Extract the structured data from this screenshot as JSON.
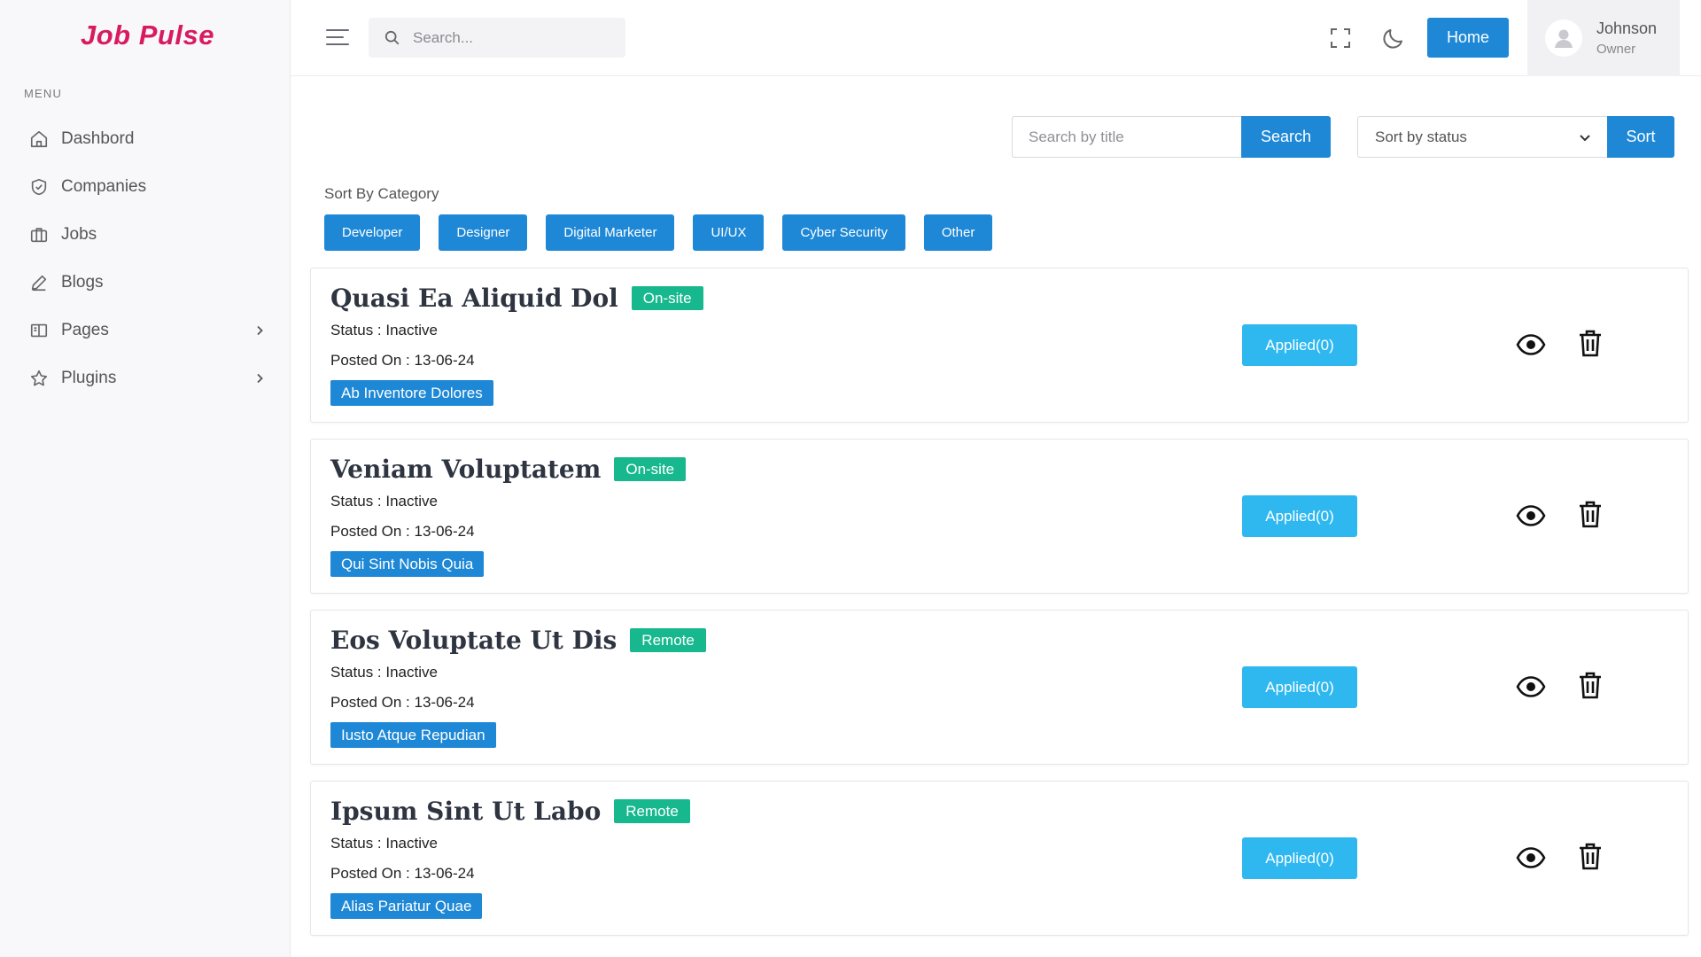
{
  "brand": "Job Pulse",
  "sidebar": {
    "menu_label": "MENU",
    "items": [
      {
        "label": "Dashbord",
        "icon": "home-icon"
      },
      {
        "label": "Companies",
        "icon": "shield-icon"
      },
      {
        "label": "Jobs",
        "icon": "briefcase-icon"
      },
      {
        "label": "Blogs",
        "icon": "pen-icon"
      },
      {
        "label": "Pages",
        "icon": "book-icon",
        "has_submenu": true
      },
      {
        "label": "Plugins",
        "icon": "star-icon",
        "has_submenu": true
      }
    ]
  },
  "header": {
    "search_placeholder": "Search...",
    "home_label": "Home",
    "user": {
      "name": "Johnson",
      "role": "Owner"
    }
  },
  "toolbar": {
    "title_search_placeholder": "Search by title",
    "search_label": "Search",
    "sort_select_value": "Sort by status",
    "sort_label": "Sort"
  },
  "categories": {
    "label": "Sort By Category",
    "items": [
      "Developer",
      "Designer",
      "Digital Marketer",
      "UI/UX",
      "Cyber Security",
      "Other"
    ]
  },
  "jobs": [
    {
      "title": "Quasi Ea Aliquid Dol",
      "type": "On-site",
      "status": "Status : Inactive",
      "posted": "Posted On : 13-06-24",
      "company": "Ab Inventore Dolores",
      "applied": "Applied(0)"
    },
    {
      "title": "Veniam Voluptatem",
      "type": "On-site",
      "status": "Status : Inactive",
      "posted": "Posted On : 13-06-24",
      "company": "Qui Sint Nobis Quia",
      "applied": "Applied(0)"
    },
    {
      "title": "Eos Voluptate Ut Dis",
      "type": "Remote",
      "status": "Status : Inactive",
      "posted": "Posted On : 13-06-24",
      "company": "Iusto Atque Repudian",
      "applied": "Applied(0)"
    },
    {
      "title": "Ipsum Sint Ut Labo",
      "type": "Remote",
      "status": "Status : Inactive",
      "posted": "Posted On : 13-06-24",
      "company": "Alias Pariatur Quae",
      "applied": "Applied(0)"
    }
  ],
  "colors": {
    "brand": "#d81b60",
    "primary": "#1e88d6",
    "applied": "#2fb8f0",
    "badge": "#18b88f"
  }
}
